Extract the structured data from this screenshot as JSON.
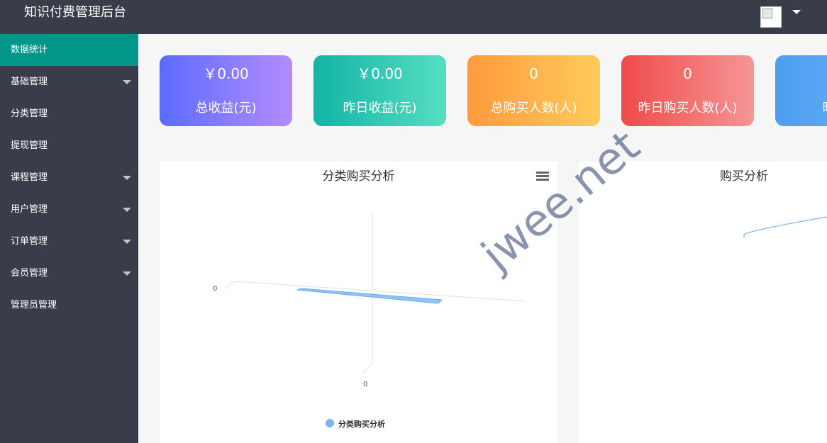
{
  "header": {
    "title": "知识付费管理后台"
  },
  "sidebar": {
    "items": [
      {
        "label": "数据统计",
        "active": true,
        "has_submenu": false
      },
      {
        "label": "基础管理",
        "active": false,
        "has_submenu": true
      },
      {
        "label": "分类管理",
        "active": false,
        "has_submenu": false
      },
      {
        "label": "提现管理",
        "active": false,
        "has_submenu": false
      },
      {
        "label": "课程管理",
        "active": false,
        "has_submenu": true
      },
      {
        "label": "用户管理",
        "active": false,
        "has_submenu": true
      },
      {
        "label": "订单管理",
        "active": false,
        "has_submenu": true
      },
      {
        "label": "会员管理",
        "active": false,
        "has_submenu": true
      },
      {
        "label": "管理员管理",
        "active": false,
        "has_submenu": false
      }
    ]
  },
  "stats": [
    {
      "value": "￥0.00",
      "label": "总收益(元)"
    },
    {
      "value": "￥0.00",
      "label": "昨日收益(元)"
    },
    {
      "value": "0",
      "label": "总购买人数(人)"
    },
    {
      "value": "0",
      "label": "昨日购买人数(人)"
    },
    {
      "value": "",
      "label": "昨日浏"
    }
  ],
  "charts": {
    "left_title": "分类购买分析",
    "right_title": "购买分析",
    "legend_label": "分类购买分析",
    "axis_y_zero": "0",
    "axis_x_zero": "0"
  },
  "watermark": "jwee.net",
  "chart_data": [
    {
      "type": "bar",
      "title": "分类购买分析",
      "categories": [],
      "series": [
        {
          "name": "分类购买分析",
          "values": [
            0
          ]
        }
      ],
      "xlabel": "",
      "ylabel": "",
      "legend": "bottom-center"
    },
    {
      "type": "line",
      "title": "购买分析",
      "x": [],
      "series": [],
      "xlabel": "",
      "ylabel": ""
    }
  ],
  "colors": {
    "header_bg": "#393d49",
    "active_nav": "#009688",
    "series_color": "#7cb5ec"
  },
  "icons": {
    "menu": "hamburger-icon",
    "dropdown": "chevron-down-icon",
    "avatar": "broken-image-icon"
  }
}
